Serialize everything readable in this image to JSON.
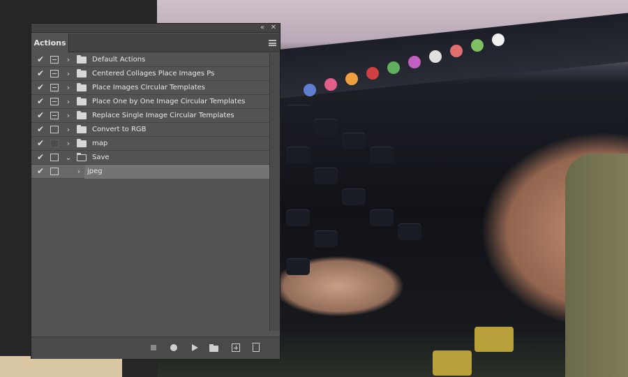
{
  "panel": {
    "tab_label": "Actions",
    "collapse_icon": "double-chevron-left-icon",
    "close_icon": "close-icon",
    "menu_icon": "panel-menu-icon"
  },
  "actions": [
    {
      "label": "Default Actions",
      "checked": true,
      "dialog": "on",
      "expanded": false,
      "type": "set"
    },
    {
      "label": "Centered Collages Place Images Ps",
      "checked": true,
      "dialog": "on",
      "expanded": false,
      "type": "set"
    },
    {
      "label": "Place Images Circular Templates",
      "checked": true,
      "dialog": "on",
      "expanded": false,
      "type": "set"
    },
    {
      "label": "Place One by One Image Circular Templates",
      "checked": true,
      "dialog": "on",
      "expanded": false,
      "type": "set"
    },
    {
      "label": "Replace Single Image Circular Templates",
      "checked": true,
      "dialog": "on",
      "expanded": false,
      "type": "set"
    },
    {
      "label": "Convert to RGB",
      "checked": true,
      "dialog": "empty",
      "expanded": false,
      "type": "set"
    },
    {
      "label": "map",
      "checked": true,
      "dialog": "off",
      "expanded": false,
      "type": "set"
    },
    {
      "label": "Save",
      "checked": true,
      "dialog": "empty",
      "expanded": true,
      "type": "set"
    },
    {
      "label": "jpeg",
      "checked": true,
      "dialog": "empty",
      "expanded": false,
      "type": "action",
      "selected": true
    }
  ],
  "toolbar": {
    "stop_icon": "stop-icon",
    "record_icon": "record-icon",
    "play_icon": "play-icon",
    "new_set_icon": "folder-icon",
    "new_action_icon": "new-action-icon",
    "delete_icon": "trash-icon"
  },
  "colors": {
    "panel_bg": "#535353",
    "selected_row": "#747474",
    "text": "#e8e8e8"
  }
}
